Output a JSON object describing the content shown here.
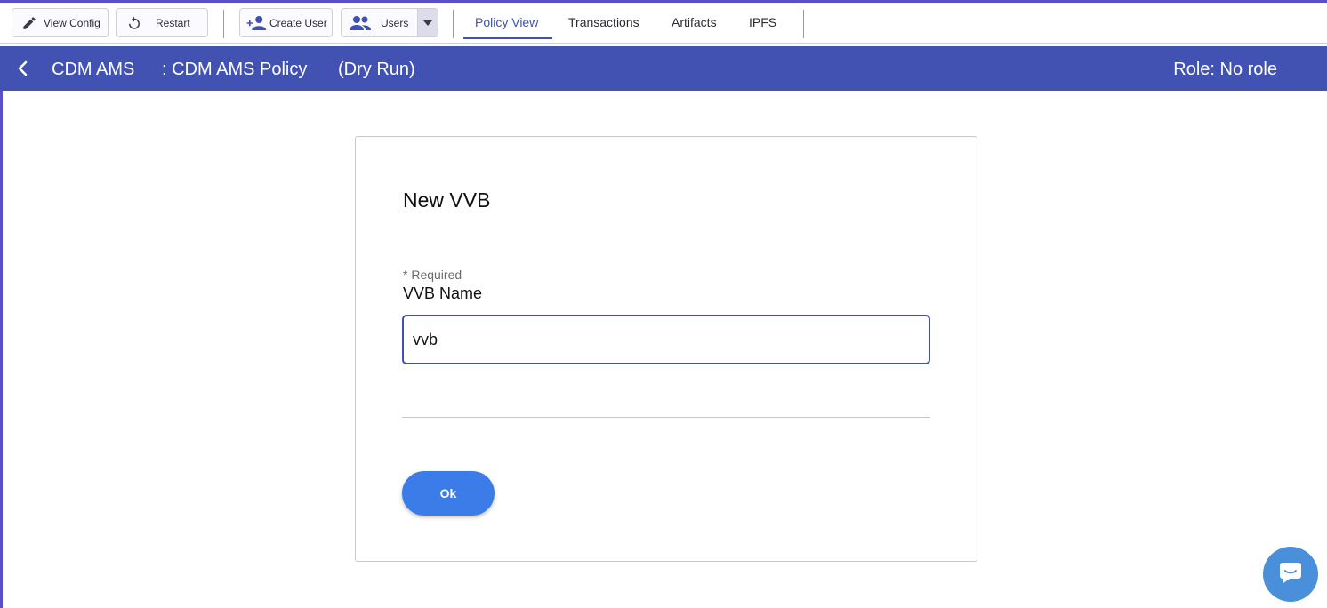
{
  "toolbar": {
    "view_config": "View Config",
    "restart": "Restart",
    "create_user": "Create User",
    "users": "Users",
    "tabs": [
      {
        "label": "Policy View",
        "active": true
      },
      {
        "label": "Transactions",
        "active": false
      },
      {
        "label": "Artifacts",
        "active": false
      },
      {
        "label": "IPFS",
        "active": false
      }
    ]
  },
  "header": {
    "policy_prefix": "CDM AMS",
    "policy_name": ": CDM AMS Policy",
    "mode": "(Dry Run)",
    "role": "Role: No role"
  },
  "dialog": {
    "title": "New VVB",
    "required_note": "* Required",
    "field_label": "VVB Name",
    "field_value": "vvb",
    "ok_label": "Ok"
  },
  "colors": {
    "header_bg": "#4152b3",
    "accent": "#3f51b5",
    "primary_button": "#3b7ce8",
    "chat_button": "#4a8fd9"
  },
  "icons": [
    "pencil-icon",
    "restart-icon",
    "add-user-icon",
    "users-icon",
    "dropdown-arrow-icon",
    "back-chevron-icon",
    "chat-icon"
  ]
}
